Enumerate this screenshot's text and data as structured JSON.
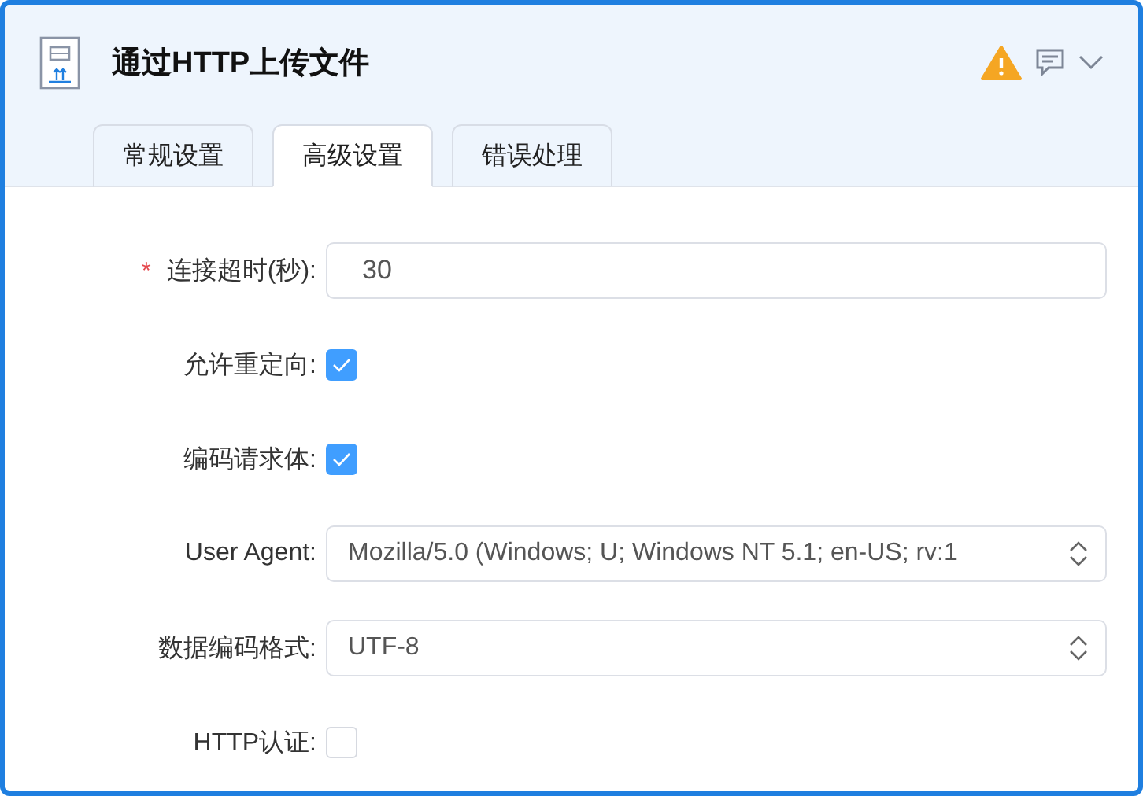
{
  "window": {
    "title": "通过HTTP上传文件"
  },
  "tabs": [
    {
      "label": "常规设置",
      "selected": false
    },
    {
      "label": "高级设置",
      "selected": true
    },
    {
      "label": "错误处理",
      "selected": false
    }
  ],
  "fields": [
    {
      "kind": "text",
      "required_mark": "*",
      "label": "连接超时(秒):",
      "value": "30"
    },
    {
      "kind": "checkbox",
      "label": "允许重定向:",
      "checked": true
    },
    {
      "kind": "checkbox",
      "label": "编码请求体:",
      "checked": true
    },
    {
      "kind": "select",
      "label": "User Agent:",
      "value": "Mozilla/5.0 (Windows; U; Windows NT 5.1; en-US; rv:1"
    },
    {
      "kind": "select",
      "label": "数据编码格式:",
      "value": "UTF-8"
    },
    {
      "kind": "checkbox",
      "label": "HTTP认证:",
      "checked": false
    }
  ]
}
